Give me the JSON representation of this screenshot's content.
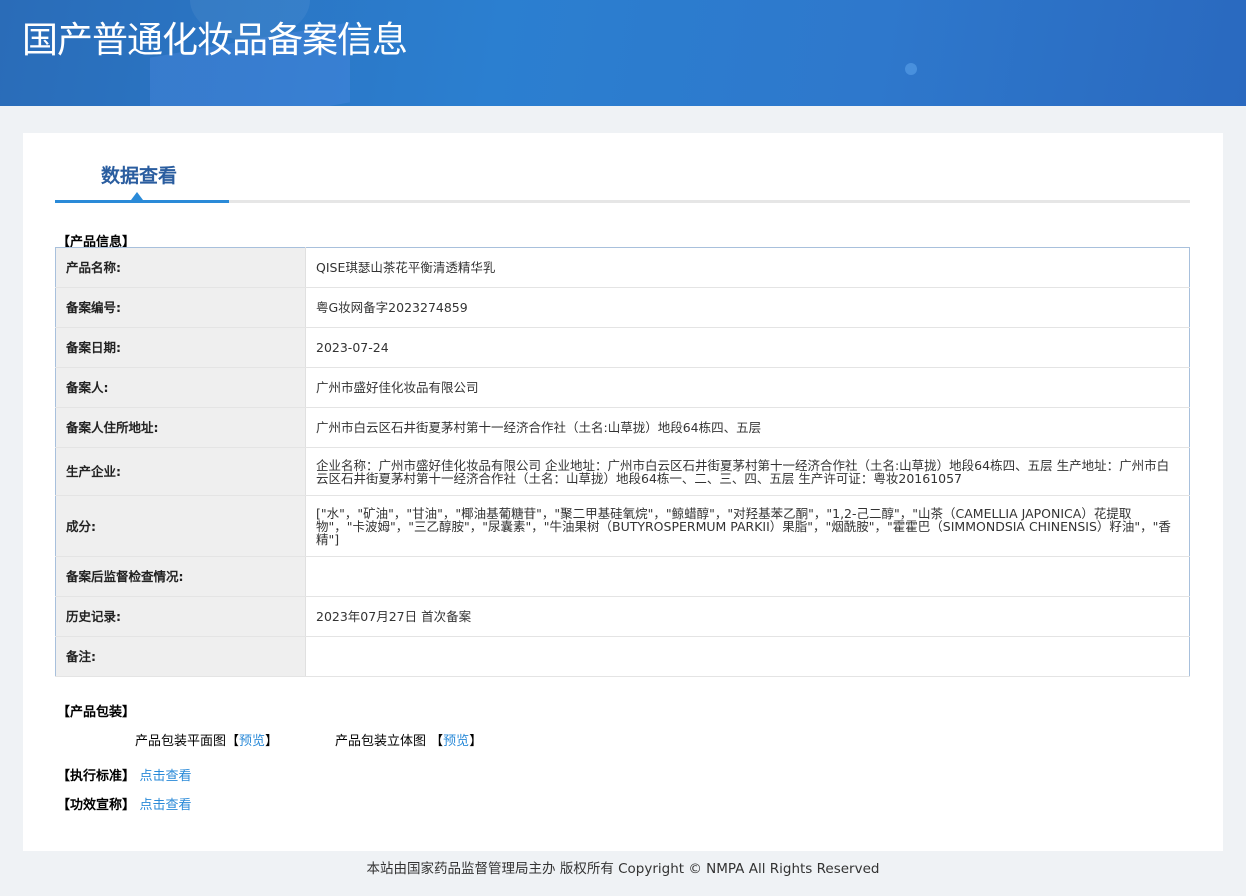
{
  "header": {
    "title": "国产普通化妆品备案信息"
  },
  "tab": {
    "label": "数据查看"
  },
  "product_info": {
    "heading": "【产品信息】",
    "rows": [
      {
        "label": "产品名称:",
        "value": "QISE琪瑟山茶花平衡清透精华乳"
      },
      {
        "label": "备案编号:",
        "value": "粤G妆网备字2023274859"
      },
      {
        "label": "备案日期:",
        "value": "2023-07-24"
      },
      {
        "label": "备案人:",
        "value": "广州市盛好佳化妆品有限公司"
      },
      {
        "label": "备案人住所地址:",
        "value": "广州市白云区石井街夏茅村第十一经济合作社（土名:山草拢）地段64栋四、五层"
      },
      {
        "label": "生产企业:",
        "value": "企业名称：广州市盛好佳化妆品有限公司 企业地址：广州市白云区石井街夏茅村第十一经济合作社（土名:山草拢）地段64栋四、五层 生产地址：广州市白云区石井街夏茅村第十一经济合作社（土名：山草拢）地段64栋一、二、三、四、五层 生产许可证：粤妆20161057"
      },
      {
        "label": "成分:",
        "value": "[\"水\"，\"矿油\"，\"甘油\"，\"椰油基葡糖苷\"，\"聚二甲基硅氧烷\"，\"鲸蜡醇\"，\"对羟基苯乙酮\"，\"1,2-己二醇\"，\"山茶（CAMELLIA JAPONICA）花提取物\"，\"卡波姆\"，\"三乙醇胺\"，\"尿囊素\"，\"牛油果树（BUTYROSPERMUM PARKII）果脂\"，\"烟酰胺\"，\"霍霍巴（SIMMONDSIA CHINENSIS）籽油\"，\"香精\"]"
      },
      {
        "label": "备案后监督检查情况:",
        "value": ""
      },
      {
        "label": "历史记录:",
        "value": "2023年07月27日 首次备案"
      },
      {
        "label": "备注:",
        "value": ""
      }
    ]
  },
  "packaging": {
    "heading": "【产品包装】",
    "flat_label": "产品包装平面图",
    "three_d_label": "产品包装立体图",
    "preview": "预览",
    "bracket_open": "【",
    "bracket_close": "】"
  },
  "standard": {
    "heading": "【执行标准】",
    "link": "点击查看"
  },
  "claims": {
    "heading": "【功效宣称】",
    "link": "点击查看"
  },
  "footer": {
    "text": "本站由国家药品监督管理局主办 版权所有 Copyright © NMPA All Rights Reserved"
  }
}
